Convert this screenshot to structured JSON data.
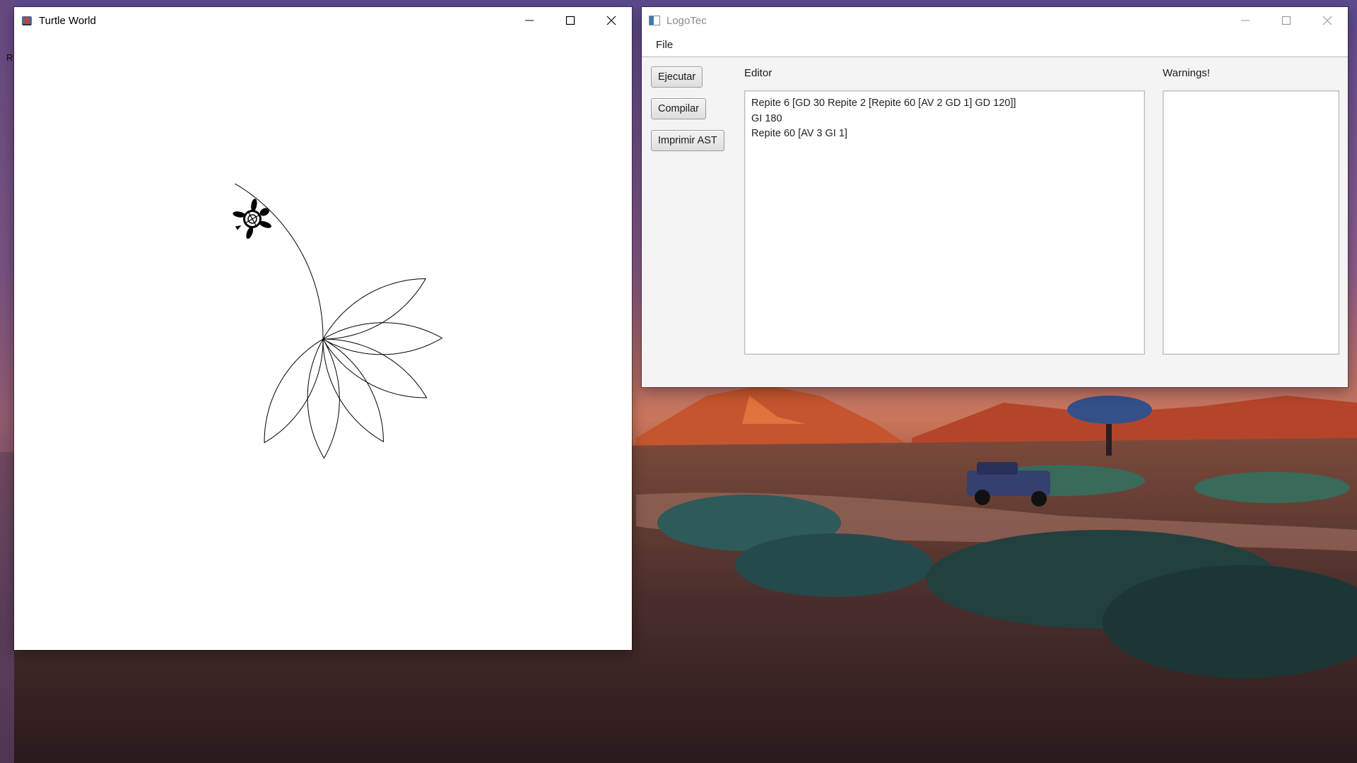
{
  "turtle_window": {
    "title": "Turtle World",
    "icon": "java-cup-icon"
  },
  "logotec_window": {
    "title": "LogoTec",
    "icon": "app-window-icon",
    "menu": {
      "file": "File"
    },
    "buttons": {
      "run": "Ejecutar",
      "compile": "Compilar",
      "print_ast": "Imprimir AST"
    },
    "editor_label": "Editor",
    "warnings_label": "Warnings!",
    "editor_lines": [
      "Repite 6 [GD 30 Repite 2 [Repite 60 [AV 2 GD 1] GD 120]]",
      "GI 180",
      "Repite 60 [AV 3 GI 1]"
    ],
    "warnings_text": ""
  },
  "desktop": {
    "edge_label": "R"
  },
  "colors": {
    "window_bg": "#ffffff",
    "panel_bg": "#f4f4f4",
    "stroke": "#000000"
  }
}
